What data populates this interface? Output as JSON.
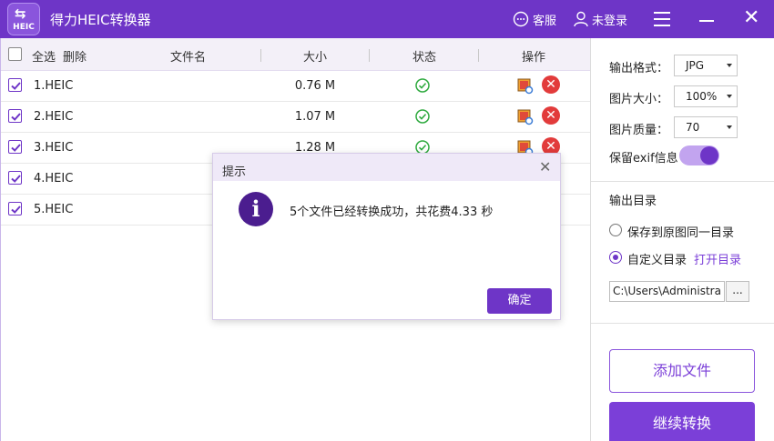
{
  "app": {
    "title": "得力HEIC转换器",
    "logo_text": "HEIC",
    "service_label": "客服",
    "login_label": "未登录"
  },
  "table": {
    "headers": {
      "select_all": "全选",
      "delete": "删除",
      "filename": "文件名",
      "size": "大小",
      "status": "状态",
      "actions": "操作"
    },
    "rows": [
      {
        "name": "1.HEIC",
        "size": "0.76 M",
        "checked": true,
        "status": "success"
      },
      {
        "name": "2.HEIC",
        "size": "1.07 M",
        "checked": true,
        "status": "success"
      },
      {
        "name": "3.HEIC",
        "size": "1.28 M",
        "checked": true,
        "status": "success"
      },
      {
        "name": "4.HEIC",
        "size": "",
        "checked": true,
        "status": ""
      },
      {
        "name": "5.HEIC",
        "size": "",
        "checked": true,
        "status": ""
      }
    ]
  },
  "settings": {
    "format_label": "输出格式：",
    "format_value": "JPG",
    "size_label": "图片大小：",
    "size_value": "100%",
    "quality_label": "图片质量：",
    "quality_value": "70",
    "exif_label": "保留exif信息",
    "exif_on": true,
    "output_dir_label": "输出目录",
    "radio_same": "保存到原图同一目录",
    "radio_custom": "自定义目录",
    "open_dir_link": "打开目录",
    "path_value": "C:\\Users\\Administra",
    "browse_label": "...",
    "add_button": "添加文件",
    "continue_button": "继续转换"
  },
  "dialog": {
    "title": "提示",
    "message": "5个文件已经转换成功，共花费4.33 秒",
    "ok_label": "确定"
  },
  "colors": {
    "brand": "#6e35c7",
    "accent": "#7b3fd8",
    "success": "#2faa3f",
    "danger": "#e23b3b"
  }
}
